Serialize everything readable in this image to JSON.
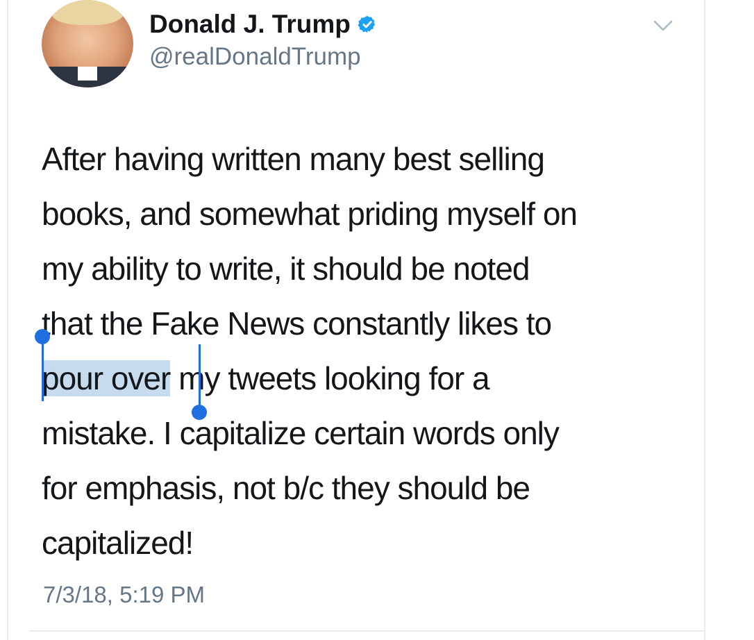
{
  "author": {
    "display_name": "Donald J. Trump",
    "handle": "@realDonaldTrump",
    "verified": true,
    "verified_color": "#1da1f2",
    "avatar_icon": "profile-photo"
  },
  "menu": {
    "icon": "chevron-down-icon"
  },
  "tweet": {
    "lines": [
      "After having written many best selling",
      "books, and somewhat priding myself on",
      "my ability to write, it should be noted",
      "that the Fake News constantly likes to",
      "pour over",
      " my tweets looking for a",
      "mistake. I capitalize certain words only",
      "for emphasis, not b/c they should be",
      "capitalized!"
    ],
    "selected_text": "pour over",
    "selection_color": "#c7dbef",
    "selection_handle_color": "#1f6fe0"
  },
  "timestamp": "7/3/18, 5:19 PM"
}
